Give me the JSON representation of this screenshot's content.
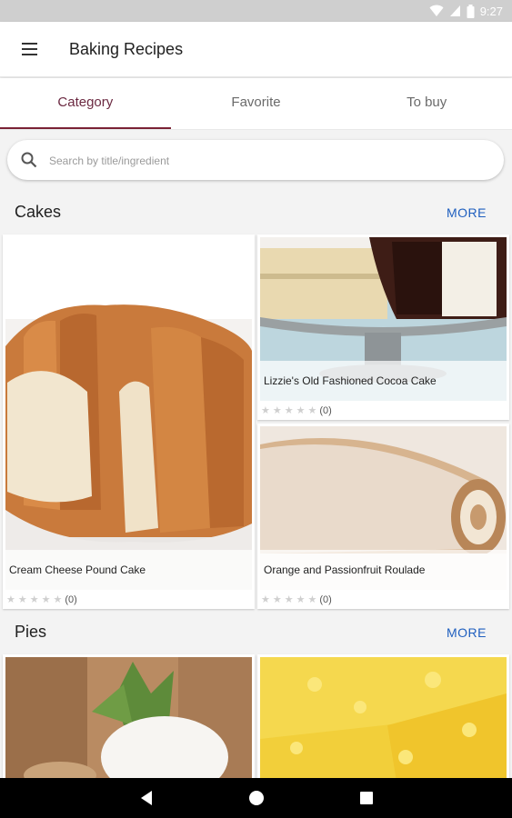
{
  "status": {
    "time": "9:27"
  },
  "app": {
    "title": "Baking Recipes"
  },
  "tabs": [
    {
      "label": "Category"
    },
    {
      "label": "Favorite"
    },
    {
      "label": "To buy"
    }
  ],
  "search": {
    "placeholder": "Search by title/ingredient"
  },
  "sections": [
    {
      "title": "Cakes",
      "more_label": "MORE",
      "cards": [
        {
          "title": "Cream Cheese Pound Cake",
          "rating": 0,
          "count": "(0)"
        },
        {
          "title": "Lizzie's Old Fashioned Cocoa Cake",
          "rating": 0,
          "count": "(0)"
        },
        {
          "title": "Orange and Passionfruit Roulade",
          "rating": 0,
          "count": "(0)"
        }
      ]
    },
    {
      "title": "Pies",
      "more_label": "MORE",
      "cards": []
    }
  ],
  "icons": {
    "menu": "hamburger-icon",
    "search": "magnifier-icon",
    "back": "triangle-back-icon",
    "home": "circle-home-icon",
    "recents": "square-recents-icon"
  },
  "colors": {
    "accent": "#7a2234",
    "link": "#1f5fbf"
  }
}
